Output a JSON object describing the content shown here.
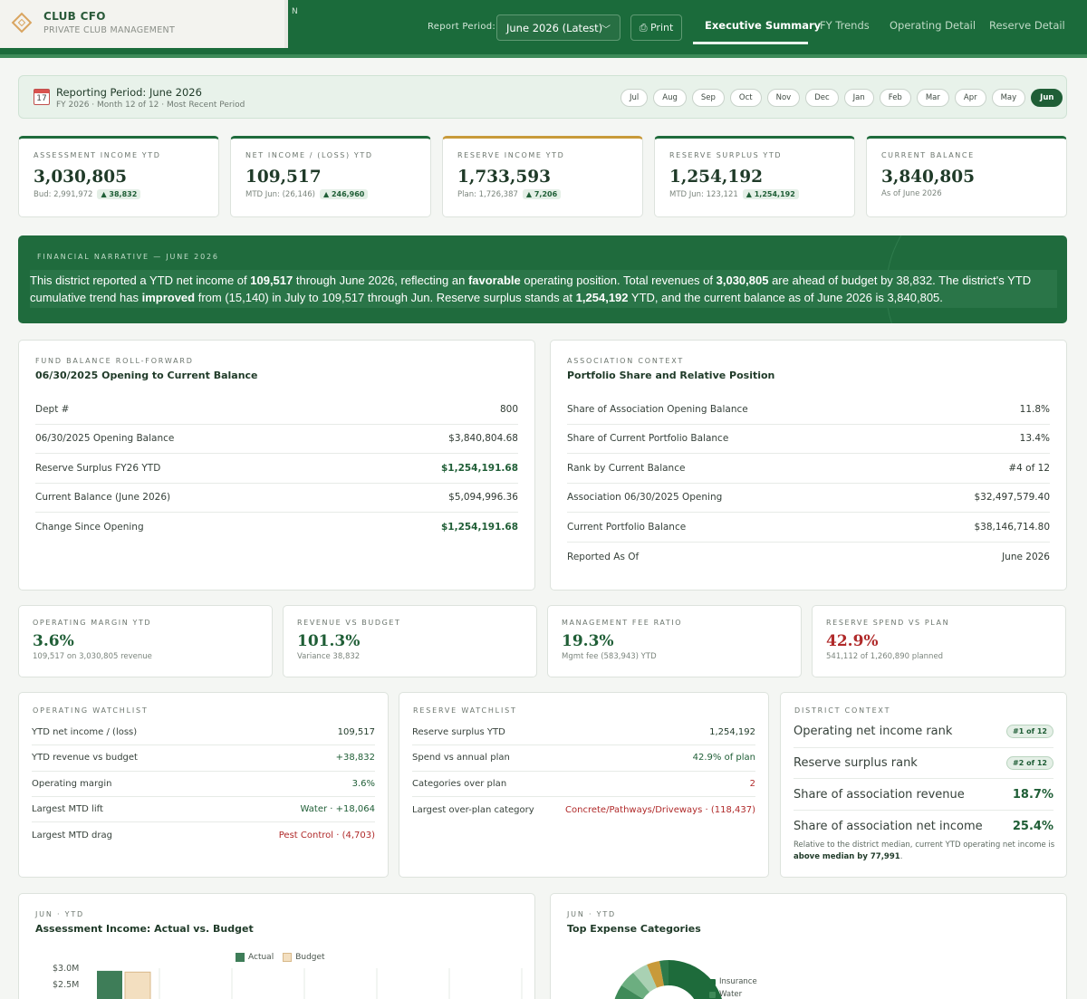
{
  "app": {
    "brand_name": "CLUB CFO",
    "brand_sub": "PRIVATE CLUB MANAGEMENT",
    "partial_char": "N"
  },
  "header": {
    "report_period_label": "Report Period:",
    "report_period_value": "June 2026 (Latest)",
    "print_label": "⎙ Print",
    "tabs": [
      {
        "label": "Executive Summary",
        "active": true
      },
      {
        "label": "FY Trends",
        "active": false
      },
      {
        "label": "Operating Detail",
        "active": false
      },
      {
        "label": "Reserve Detail",
        "active": false
      }
    ]
  },
  "period": {
    "title": "Reporting Period: June 2026",
    "subtitle": "FY 2026 · Month 12 of 12 · Most Recent Period",
    "calendar_day": "17",
    "months": [
      "Jul",
      "Aug",
      "Sep",
      "Oct",
      "Nov",
      "Dec",
      "Jan",
      "Feb",
      "Mar",
      "Apr",
      "May",
      "Jun"
    ],
    "active_month": "Jun"
  },
  "kpis": [
    {
      "label": "ASSESSMENT INCOME YTD",
      "value": "3,030,805",
      "sub": "Bud: 2,991,972",
      "badge": "▲ 38,832"
    },
    {
      "label": "NET INCOME / (LOSS) YTD",
      "value": "109,517",
      "sub": "MTD Jun: (26,146)",
      "badge": "▲ 246,960"
    },
    {
      "label": "RESERVE INCOME YTD",
      "value": "1,733,593",
      "sub": "Plan: 1,726,387",
      "badge": "▲ 7,206"
    },
    {
      "label": "RESERVE SURPLUS YTD",
      "value": "1,254,192",
      "sub": "MTD Jun: 123,121",
      "badge": "▲ 1,254,192"
    },
    {
      "label": "CURRENT BALANCE",
      "value": "3,840,805",
      "sub": "As of June 2026",
      "badge": ""
    }
  ],
  "narrative": {
    "label": "FINANCIAL NARRATIVE — JUNE 2026",
    "parts": [
      "This district reported a YTD net income of ",
      "109,517",
      " through June 2026, reflecting an ",
      "favorable",
      " operating position. Total revenues of ",
      "3,030,805",
      " are ahead of budget by 38,832. The district's YTD cumulative trend has ",
      "improved",
      " from (15,140) in July to 109,517 through Jun. Reserve surplus stands at ",
      "1,254,192",
      " YTD, and the current balance as of June 2026 is 3,840,805."
    ]
  },
  "fund_balance": {
    "label": "FUND BALANCE ROLL-FORWARD",
    "title": "06/30/2025 Opening to Current Balance",
    "rows": [
      {
        "k": "Dept #",
        "v": "800"
      },
      {
        "k": "06/30/2025 Opening Balance",
        "v": "$3,840,804.68"
      },
      {
        "k": "Reserve Surplus FY26 YTD",
        "v": "$1,254,191.68"
      },
      {
        "k": "Current Balance (June 2026)",
        "v": "$5,094,996.36"
      },
      {
        "k": "Change Since Opening",
        "v": "$1,254,191.68"
      }
    ]
  },
  "association": {
    "label": "ASSOCIATION CONTEXT",
    "title": "Portfolio Share and Relative Position",
    "rows": [
      {
        "k": "Share of Association Opening Balance",
        "v": "11.8%"
      },
      {
        "k": "Share of Current Portfolio Balance",
        "v": "13.4%"
      },
      {
        "k": "Rank by Current Balance",
        "v": "#4 of 12"
      },
      {
        "k": "Association 06/30/2025 Opening",
        "v": "$32,497,579.40"
      },
      {
        "k": "Current Portfolio Balance",
        "v": "$38,146,714.80"
      },
      {
        "k": "Reported As Of",
        "v": "June 2026"
      }
    ]
  },
  "ratios": [
    {
      "label": "OPERATING MARGIN YTD",
      "value": "3.6%",
      "sub": "109,517 on 3,030,805 revenue"
    },
    {
      "label": "REVENUE VS BUDGET",
      "value": "101.3%",
      "sub": "Variance 38,832"
    },
    {
      "label": "MANAGEMENT FEE RATIO",
      "value": "19.3%",
      "sub": "Mgmt fee (583,943) YTD"
    },
    {
      "label": "RESERVE SPEND VS PLAN",
      "value": "42.9%",
      "sub": "541,112 of 1,260,890 planned"
    }
  ],
  "operating_watchlist": {
    "label": "OPERATING WATCHLIST",
    "rows": [
      {
        "k": "YTD net income / (loss)",
        "v": "109,517"
      },
      {
        "k": "YTD revenue vs budget",
        "v": "+38,832"
      },
      {
        "k": "Operating margin",
        "v": "3.6%"
      },
      {
        "k": "Largest MTD lift",
        "v": "Water · +18,064"
      },
      {
        "k": "Largest MTD drag",
        "v": "Pest Control · (4,703)"
      }
    ]
  },
  "reserve_watchlist": {
    "label": "RESERVE WATCHLIST",
    "rows": [
      {
        "k": "Reserve surplus YTD",
        "v": "1,254,192"
      },
      {
        "k": "Spend vs annual plan",
        "v": "42.9% of plan"
      },
      {
        "k": "Categories over plan",
        "v": "2"
      },
      {
        "k": "Largest over-plan category",
        "v": "Concrete/Pathways/Driveways · (118,437)"
      }
    ]
  },
  "district_context": {
    "label": "DISTRICT CONTEXT",
    "rows": [
      {
        "k": "Operating net income rank",
        "v": "#1 of 12",
        "pill": true
      },
      {
        "k": "Reserve surplus rank",
        "v": "#2 of 12",
        "pill": true
      },
      {
        "k": "Share of association revenue",
        "v": "18.7%",
        "pill": false
      },
      {
        "k": "Share of association net income",
        "v": "25.4%",
        "pill": false
      }
    ],
    "note_pre": "Relative to the district median, current YTD operating net income is ",
    "note_bold": "above median by 77,991",
    "note_post": "."
  },
  "charts": {
    "assessment": {
      "label": "JUN · YTD",
      "title": "Assessment Income: Actual vs. Budget",
      "legend_actual": "Actual",
      "legend_budget": "Budget",
      "y_ticks": [
        "$3.0M",
        "$2.5M"
      ]
    },
    "expense": {
      "label": "JUN · YTD",
      "title": "Top Expense Categories",
      "legend": [
        "Insurance",
        "Water"
      ]
    }
  },
  "chart_data": [
    {
      "type": "bar",
      "categories": [
        ""
      ],
      "series": [
        {
          "name": "Actual",
          "values": [
            3030805
          ]
        },
        {
          "name": "Budget",
          "values": [
            2991972
          ]
        }
      ],
      "title": "Assessment Income: Actual vs. Budget",
      "ylabel": "",
      "legend": "top-center"
    },
    {
      "type": "pie",
      "title": "Top Expense Categories",
      "labels": [
        "Insurance",
        "Water"
      ],
      "legend": "right"
    }
  ],
  "colors": {
    "primary": "#1b6b3b",
    "accent_gold": "#c89a3a",
    "negative": "#b02a2a",
    "actual_bar": "#3e7d58",
    "budget_bar": "#f3dfc0"
  }
}
